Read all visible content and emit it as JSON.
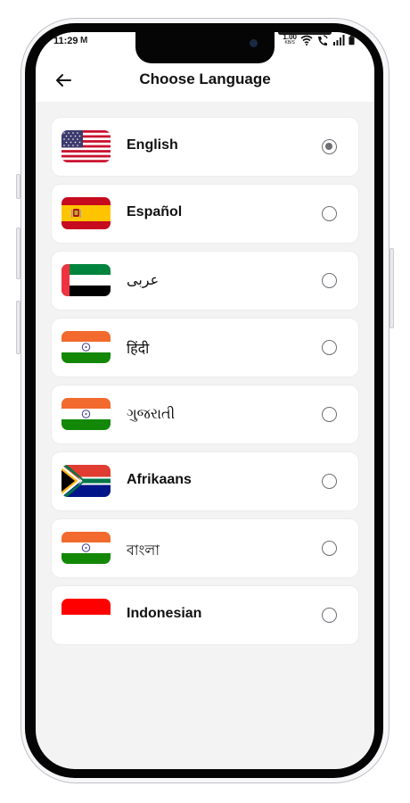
{
  "status_bar": {
    "time": "11:29",
    "notification_icon": "gmail-icon",
    "net_speed_value": "1.00",
    "net_speed_unit": "KB/S",
    "icons": [
      "wifi-icon",
      "wifi-call-icon",
      "signal-icon",
      "battery-icon"
    ]
  },
  "header": {
    "back_icon": "arrow-left-icon",
    "title": "Choose Language"
  },
  "languages": [
    {
      "label": "English",
      "flag": "us",
      "selected": true
    },
    {
      "label": "Español",
      "flag": "es",
      "selected": false
    },
    {
      "label": "عربى",
      "flag": "ae",
      "selected": false
    },
    {
      "label": "हिंदी",
      "flag": "in",
      "selected": false
    },
    {
      "label": "ગુજરાતી",
      "flag": "in",
      "selected": false
    },
    {
      "label": "Afrikaans",
      "flag": "za",
      "selected": false
    },
    {
      "label": "বাংলা",
      "flag": "in",
      "selected": false
    },
    {
      "label": "Indonesian",
      "flag": "id",
      "selected": false
    }
  ],
  "colors": {
    "background": "#f3f3f4",
    "card": "#ffffff",
    "text": "#111111",
    "radio": "#6e6e74"
  }
}
